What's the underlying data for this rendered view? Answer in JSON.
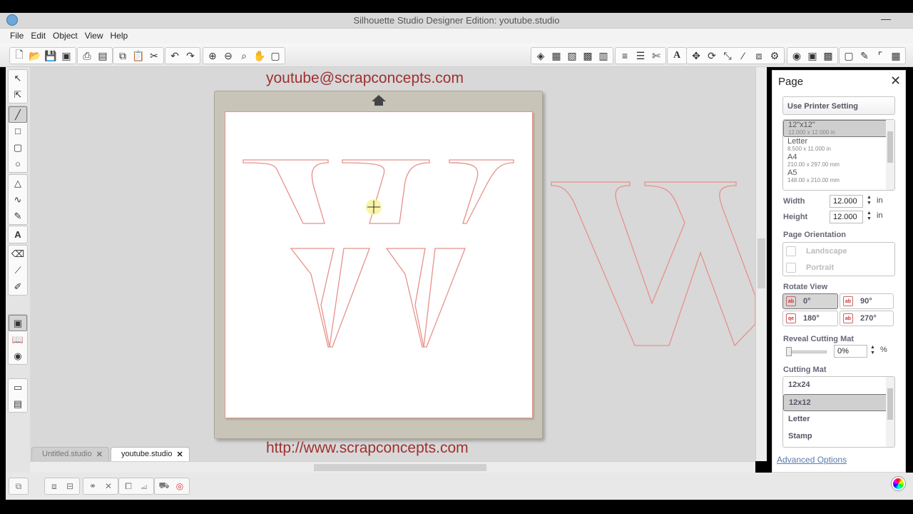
{
  "window": {
    "title": "Silhouette Studio Designer Edition: youtube.studio"
  },
  "menu": [
    "File",
    "Edit",
    "Object",
    "View",
    "Help"
  ],
  "watermark": {
    "top": "youtube@scrapconcepts.com",
    "bottom": "http://www.scrapconcepts.com"
  },
  "tabs": [
    {
      "label": "Untitled.studio",
      "active": false
    },
    {
      "label": "youtube.studio",
      "active": true
    }
  ],
  "toolbar_icons": [
    "new-icon",
    "open-icon",
    "save-icon",
    "save-library-icon",
    "print-icon",
    "print-cut-icon",
    "copy-icon",
    "paste-icon",
    "cut-icon",
    "undo-icon",
    "redo-icon",
    "zoom-in-icon",
    "zoom-out-icon",
    "zoom-select-icon",
    "pan-icon",
    "fit-page-icon"
  ],
  "panel": {
    "title": "Page",
    "printer_button": "Use Printer Setting",
    "sizes": [
      {
        "name": "12\"x12\"",
        "dims": "12.000 x 12.000 in",
        "selected": true
      },
      {
        "name": "Letter",
        "dims": "8.500 x 11.000 in",
        "selected": false
      },
      {
        "name": "A4",
        "dims": "210.00 x 297.00 mm",
        "selected": false
      },
      {
        "name": "A5",
        "dims": "148.00 x 210.00 mm",
        "selected": false
      }
    ],
    "width_label": "Width",
    "width_value": "12.000",
    "height_label": "Height",
    "height_value": "12.000",
    "unit": "in",
    "orientation_label": "Page Orientation",
    "orientation_options": [
      "Landscape",
      "Portrait"
    ],
    "rotate_label": "Rotate View",
    "rotate_options": [
      {
        "label": "0°",
        "selected": true
      },
      {
        "label": "90°",
        "selected": false
      },
      {
        "label": "180°",
        "selected": false
      },
      {
        "label": "270°",
        "selected": false
      }
    ],
    "reveal_label": "Reveal Cutting Mat",
    "reveal_value": "0%",
    "reveal_unit": "%",
    "reveal_level": 0,
    "mat_label": "Cutting Mat",
    "mats": [
      {
        "label": "12x24",
        "selected": false
      },
      {
        "label": "12x12",
        "selected": true
      },
      {
        "label": "Letter",
        "selected": false
      },
      {
        "label": "Stamp",
        "selected": false
      }
    ],
    "advanced_link": "Advanced Options"
  },
  "colors": {
    "cut_line": "#e8908a",
    "watermark": "#a03030",
    "mat": "#c8c5b8"
  }
}
